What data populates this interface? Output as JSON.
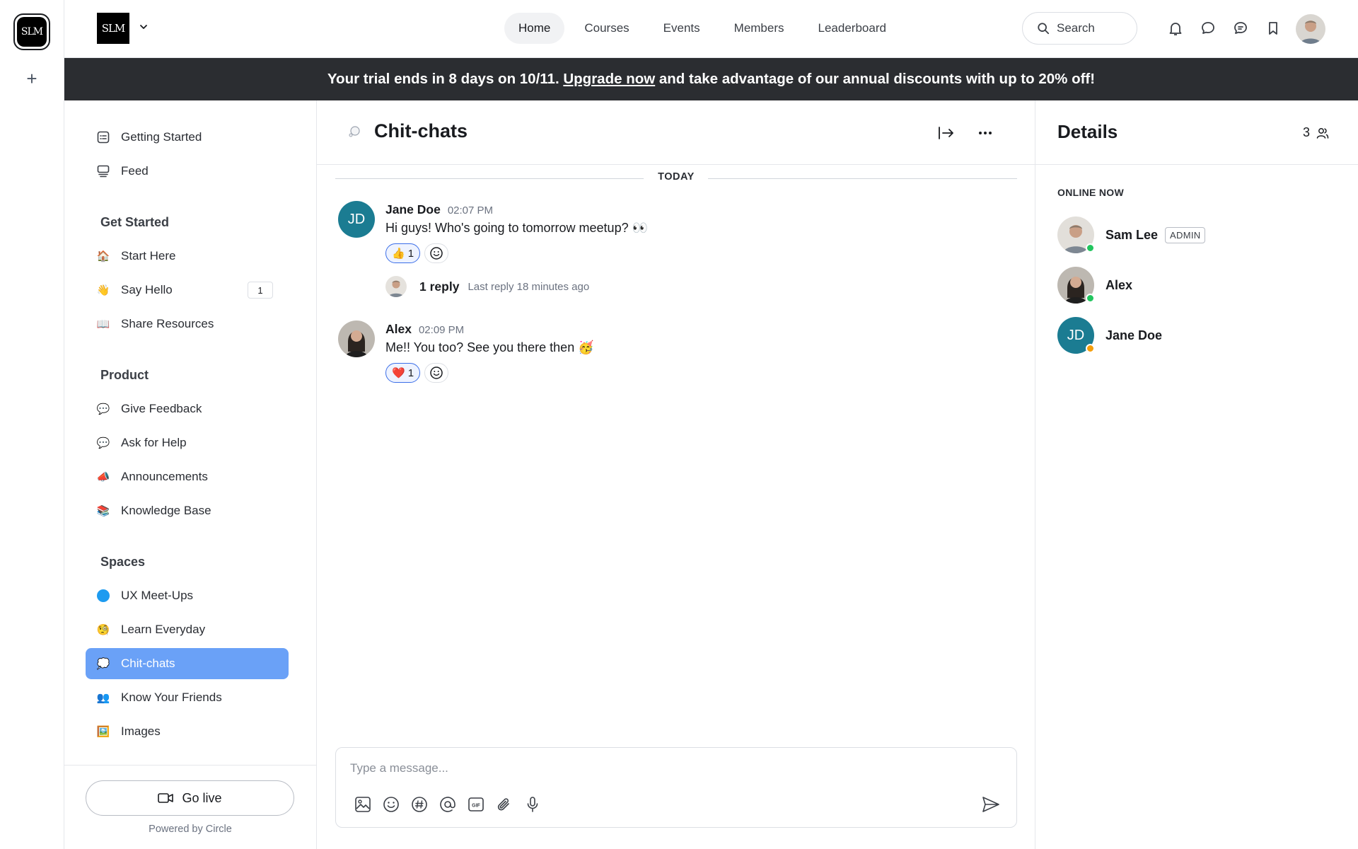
{
  "rail": {
    "logo_text": "SLM",
    "add_label": "+"
  },
  "header": {
    "brand_text": "SLM",
    "nav": [
      {
        "label": "Home"
      },
      {
        "label": "Courses"
      },
      {
        "label": "Events"
      },
      {
        "label": "Members"
      },
      {
        "label": "Leaderboard"
      }
    ],
    "search_label": "Search"
  },
  "banner": {
    "text_before": "Your trial ends in 8 days on 10/11. ",
    "link_text": "Upgrade now",
    "text_after": " and take advantage of our annual discounts with up to 20% off!"
  },
  "sidebar": {
    "top_items": [
      {
        "label": "Getting Started",
        "icon": "checklist-icon"
      },
      {
        "label": "Feed",
        "icon": "feed-icon"
      }
    ],
    "groups": [
      {
        "heading": "Get Started",
        "items": [
          {
            "label": "Start Here",
            "emoji": "🏠"
          },
          {
            "label": "Say Hello",
            "emoji": "👋",
            "badge": "1"
          },
          {
            "label": "Share Resources",
            "emoji": "📖"
          }
        ]
      },
      {
        "heading": "Product",
        "items": [
          {
            "label": "Give Feedback",
            "emoji": "💬"
          },
          {
            "label": "Ask for Help",
            "emoji": "💬"
          },
          {
            "label": "Announcements",
            "emoji": "📣"
          },
          {
            "label": "Knowledge Base",
            "emoji": "📚"
          }
        ]
      },
      {
        "heading": "Spaces",
        "items": [
          {
            "label": "UX Meet-Ups",
            "emoji": "🔵"
          },
          {
            "label": "Learn Everyday",
            "emoji": "🧐"
          },
          {
            "label": "Chit-chats",
            "emoji": "💭",
            "active": true
          },
          {
            "label": "Know Your Friends",
            "emoji": "👥"
          },
          {
            "label": "Images",
            "emoji": "🖼️"
          }
        ]
      }
    ],
    "go_live_label": "Go live",
    "powered_by": "Powered by Circle"
  },
  "chat": {
    "title": "Chit-chats",
    "day_label": "TODAY",
    "messages": [
      {
        "author": "Jane Doe",
        "initials": "JD",
        "time": "02:07 PM",
        "body": "Hi guys! Who's going to tomorrow meetup? 👀",
        "reaction_emoji": "👍",
        "reaction_count": "1",
        "thread_count": "1 reply",
        "thread_last": "Last reply 18 minutes ago"
      },
      {
        "author": "Alex",
        "time": "02:09 PM",
        "body": "Me!! You too? See you there then 🥳",
        "reaction_emoji": "❤️",
        "reaction_count": "1"
      }
    ],
    "composer_placeholder": "Type a message..."
  },
  "details": {
    "title": "Details",
    "member_count": "3",
    "online_label": "ONLINE NOW",
    "members": [
      {
        "name": "Sam Lee",
        "role": "ADMIN",
        "status_color": "#22c55e"
      },
      {
        "name": "Alex",
        "status_color": "#22c55e"
      },
      {
        "name": "Jane Doe",
        "initials": "JD",
        "status_color": "#f59e0b"
      }
    ]
  },
  "colors": {
    "accent": "#6aa1f7",
    "banner_bg": "#2b2d31",
    "jd_avatar": "#1b7c92",
    "reaction_border": "#3b6ee8"
  }
}
